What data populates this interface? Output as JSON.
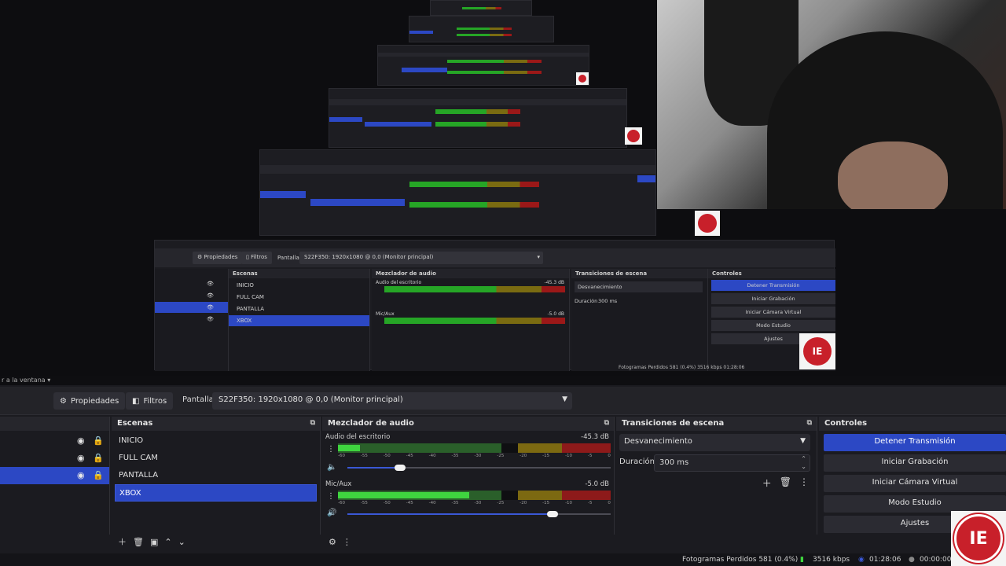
{
  "menu_strip": {
    "text": "r a la ventana"
  },
  "toolbar": {
    "properties_label": "Propiedades",
    "filters_label": "Filtros",
    "source_type_label": "Pantalla",
    "source_value": "S22F350: 1920x1080 @ 0,0 (Monitor principal)"
  },
  "scenes": {
    "title": "Escenas",
    "items": [
      {
        "label": "INICIO",
        "selected": false
      },
      {
        "label": "FULL CAM",
        "selected": false
      },
      {
        "label": "PANTALLA",
        "selected": false
      },
      {
        "label": "XBOX",
        "selected": true
      }
    ]
  },
  "mixer": {
    "title": "Mezclador de audio",
    "channels": [
      {
        "name": "Audio del escritorio",
        "db": "-45.3 dB",
        "level": 0.08,
        "volume": 0.2
      },
      {
        "name": "Mic/Aux",
        "db": "-5.0 dB",
        "level": 0.48,
        "volume": 0.78
      }
    ],
    "ticks": [
      "-60",
      "-55",
      "-50",
      "-45",
      "-40",
      "-35",
      "-30",
      "-25",
      "-20",
      "-15",
      "-10",
      "-5",
      "0"
    ]
  },
  "transitions": {
    "title": "Transiciones de escena",
    "selected": "Desvanecimiento",
    "duration_label": "Duración",
    "duration_value": "300 ms"
  },
  "controls": {
    "title": "Controles",
    "buttons": [
      {
        "label": "Detener Transmisión",
        "active": true
      },
      {
        "label": "Iniciar Grabación",
        "active": false
      },
      {
        "label": "Iniciar Cámara Virtual",
        "active": false
      },
      {
        "label": "Modo Estudio",
        "active": false
      },
      {
        "label": "Ajustes",
        "active": false
      }
    ]
  },
  "status": {
    "dropped_frames": "Fotogramas Perdidos 581 (0.4%)",
    "bitrate": "3516 kbps",
    "stream_time": "01:28:06",
    "rec_time": "00:00:00"
  },
  "inner_capture": {
    "properties_label": "Propiedades",
    "filters_label": "Filtros",
    "source_type_label": "Pantalla",
    "source_value": "S22F350: 1920x1080 @ 0,0 (Monitor principal)",
    "scenes_title": "Escenas",
    "mixer_title": "Mezclador de audio",
    "transitions_title": "Transiciones de escena",
    "controls_title": "Controles",
    "scenes": [
      "INICIO",
      "FULL CAM",
      "PANTALLA",
      "XBOX"
    ],
    "ch1_name": "Audio del escritorio",
    "ch1_db": "-45.3 dB",
    "ch2_name": "Mic/Aux",
    "ch2_db": "-5.0 dB",
    "transition": "Desvanecimiento",
    "duration_label": "Duración",
    "duration_value": "300 ms",
    "buttons": [
      "Detener Transmisión",
      "Iniciar Grabación",
      "Iniciar Cámara Virtual",
      "Modo Estudio",
      "Ajustes"
    ],
    "status": "Fotogramas Perdidos 581 (0.4%)   3516 kbps   01:28:06"
  },
  "logo_text": "IE",
  "colors": {
    "accent": "#2c48c4",
    "logo_red": "#c8202a"
  }
}
